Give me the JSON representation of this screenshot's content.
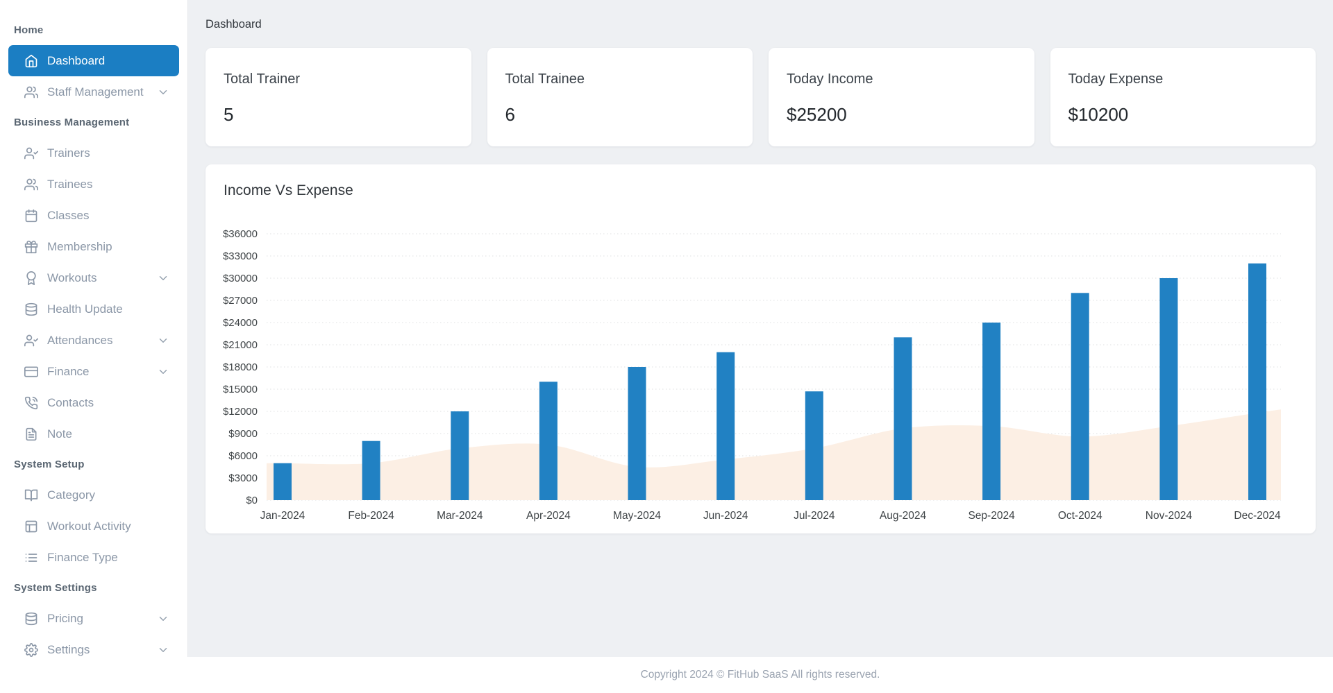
{
  "breadcrumb": "Dashboard",
  "sidebar": {
    "sections": [
      {
        "header": "Home",
        "items": [
          {
            "label": "Dashboard",
            "icon": "home",
            "active": true,
            "chevron": false
          },
          {
            "label": "Staff Management",
            "icon": "users",
            "active": false,
            "chevron": true
          }
        ]
      },
      {
        "header": "Business Management",
        "items": [
          {
            "label": "Trainers",
            "icon": "user-check",
            "active": false,
            "chevron": false
          },
          {
            "label": "Trainees",
            "icon": "users",
            "active": false,
            "chevron": false
          },
          {
            "label": "Classes",
            "icon": "calendar",
            "active": false,
            "chevron": false
          },
          {
            "label": "Membership",
            "icon": "gift",
            "active": false,
            "chevron": false
          },
          {
            "label": "Workouts",
            "icon": "award",
            "active": false,
            "chevron": true
          },
          {
            "label": "Health Update",
            "icon": "database",
            "active": false,
            "chevron": false
          },
          {
            "label": "Attendances",
            "icon": "user-check",
            "active": false,
            "chevron": true
          },
          {
            "label": "Finance",
            "icon": "credit-card",
            "active": false,
            "chevron": true
          },
          {
            "label": "Contacts",
            "icon": "phone",
            "active": false,
            "chevron": false
          },
          {
            "label": "Note",
            "icon": "file-text",
            "active": false,
            "chevron": false
          }
        ]
      },
      {
        "header": "System Setup",
        "items": [
          {
            "label": "Category",
            "icon": "book-open",
            "active": false,
            "chevron": false
          },
          {
            "label": "Workout Activity",
            "icon": "layout",
            "active": false,
            "chevron": false
          },
          {
            "label": "Finance Type",
            "icon": "list",
            "active": false,
            "chevron": false
          }
        ]
      },
      {
        "header": "System Settings",
        "items": [
          {
            "label": "Pricing",
            "icon": "database",
            "active": false,
            "chevron": true
          },
          {
            "label": "Settings",
            "icon": "settings",
            "active": false,
            "chevron": true
          }
        ]
      }
    ]
  },
  "stat_cards": [
    {
      "label": "Total Trainer",
      "value": "5"
    },
    {
      "label": "Total Trainee",
      "value": "6"
    },
    {
      "label": "Today Income",
      "value": "$25200"
    },
    {
      "label": "Today Expense",
      "value": "$10200"
    }
  ],
  "chart_data": {
    "type": "bar",
    "title": "Income Vs Expense",
    "categories": [
      "Jan-2024",
      "Feb-2024",
      "Mar-2024",
      "Apr-2024",
      "May-2024",
      "Jun-2024",
      "Jul-2024",
      "Aug-2024",
      "Sep-2024",
      "Oct-2024",
      "Nov-2024",
      "Dec-2024"
    ],
    "series": [
      {
        "name": "Income",
        "type": "bar",
        "values": [
          5000,
          8000,
          12000,
          16000,
          18000,
          20000,
          14700,
          22000,
          24000,
          28000,
          30000,
          32000
        ]
      },
      {
        "name": "Expense",
        "type": "area",
        "values": [
          5000,
          5000,
          7000,
          7500,
          4500,
          5500,
          7000,
          9700,
          10000,
          8600,
          10000,
          11800
        ]
      }
    ],
    "ylim": [
      0,
      36000
    ],
    "ytick_step": 3000,
    "ytick_prefix": "$",
    "grid": "dotted horizontal",
    "legend_position": "none"
  },
  "footer": {
    "text": "Copyright 2024 © FitHub SaaS All rights reserved."
  },
  "colors": {
    "accent": "#1b7ec3",
    "bar": "#2181c3",
    "area": "#fcefe4",
    "grid": "#dfe0e2",
    "axis_label": "#3f4447",
    "content_bg": "#eef0f3"
  }
}
